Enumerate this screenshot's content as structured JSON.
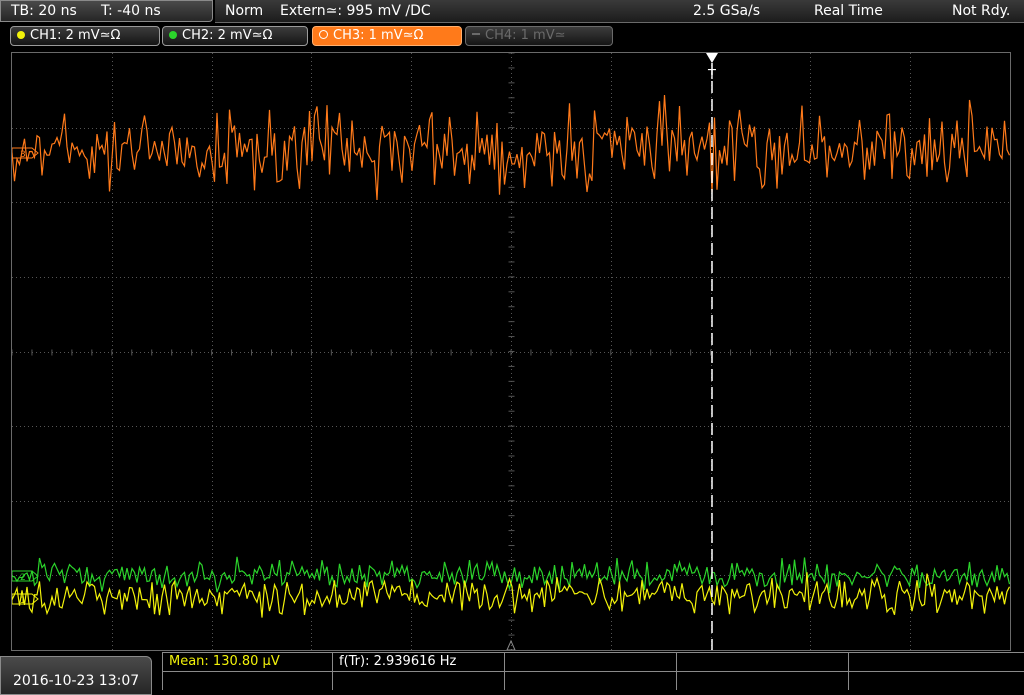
{
  "timebase": {
    "tb_label": "TB: 20 ns",
    "trigger_time_label": "T: -40 ns"
  },
  "status": {
    "mode": "Norm",
    "trigger_source": "Extern≃: 995 mV ∕DC",
    "sample_rate": "2.5 GSa/s",
    "acq_mode": "Real Time",
    "trigger_state": "Not Rdy."
  },
  "channels": [
    {
      "label": "CH1: 2 mV≃Ω",
      "color": "#f2f20a",
      "active": true
    },
    {
      "label": "CH2: 2 mV≃Ω",
      "color": "#2bd42b",
      "active": true
    },
    {
      "label": "CH3: 1 mV≃Ω",
      "color": "#ff7a1a",
      "active": true,
      "selected": true
    },
    {
      "label": "CH4: 1 mV≃",
      "color": "#6a6a6a",
      "active": false
    }
  ],
  "markers": {
    "ch1": "1",
    "ch2": "2",
    "ch3": "3",
    "trigger": "T"
  },
  "measurements": {
    "mean": "Mean: 130.80 µV",
    "frequency": "f(Tr): 2.939616 Hz"
  },
  "datetime": "2016-10-23 13:07",
  "colors": {
    "ch1": "#f2f20a",
    "ch2": "#2bd42b",
    "ch3": "#ff7a1a",
    "grid": "#555555",
    "trigger": "#ffffff"
  }
}
